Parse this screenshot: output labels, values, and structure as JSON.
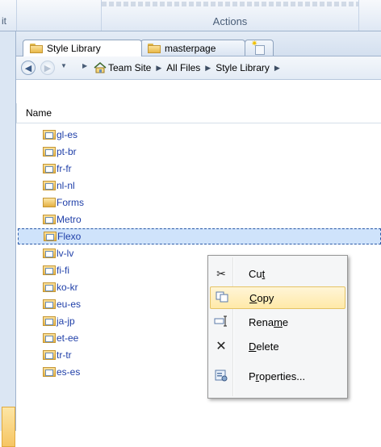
{
  "ribbon": {
    "left_label": "it",
    "group_label": "Actions"
  },
  "tabs": [
    {
      "label": "Style Library",
      "active": true
    },
    {
      "label": "masterpage",
      "active": false
    },
    {
      "label": "",
      "icon": "new-tab-icon"
    }
  ],
  "breadcrumb": [
    "Team Site",
    "All Files",
    "Style Library"
  ],
  "columns": {
    "name": "Name"
  },
  "files": [
    {
      "name": "gl-es",
      "icon": "library-folder-icon"
    },
    {
      "name": "pt-br",
      "icon": "library-folder-icon"
    },
    {
      "name": "fr-fr",
      "icon": "library-folder-icon"
    },
    {
      "name": "nl-nl",
      "icon": "library-folder-icon"
    },
    {
      "name": "Forms",
      "icon": "folder-icon"
    },
    {
      "name": "Metro",
      "icon": "library-folder-icon"
    },
    {
      "name": "Flexo",
      "icon": "library-folder-icon",
      "selected": true
    },
    {
      "name": "lv-lv",
      "icon": "library-folder-icon"
    },
    {
      "name": "fi-fi",
      "icon": "library-folder-icon"
    },
    {
      "name": "ko-kr",
      "icon": "library-folder-icon"
    },
    {
      "name": "eu-es",
      "icon": "library-folder-icon"
    },
    {
      "name": "ja-jp",
      "icon": "library-folder-icon"
    },
    {
      "name": "et-ee",
      "icon": "library-folder-icon"
    },
    {
      "name": "tr-tr",
      "icon": "library-folder-icon"
    },
    {
      "name": "es-es",
      "icon": "library-folder-icon"
    }
  ],
  "context_menu": [
    {
      "label": "Cut",
      "underline_index": 2,
      "icon": "scissors-icon"
    },
    {
      "label": "Copy",
      "underline_index": 0,
      "icon": "copy-icon",
      "highlighted": true
    },
    {
      "label": "Rename",
      "underline_index": 4,
      "icon": "rename-icon"
    },
    {
      "label": "Delete",
      "underline_index": 0,
      "icon": "delete-icon"
    },
    {
      "label": "Properties...",
      "underline_index": 1,
      "icon": "properties-icon"
    }
  ],
  "colors": {
    "accent": "#1f3fa8",
    "selection": "#cfe3fb",
    "menu_highlight": "#ffe9a8"
  }
}
